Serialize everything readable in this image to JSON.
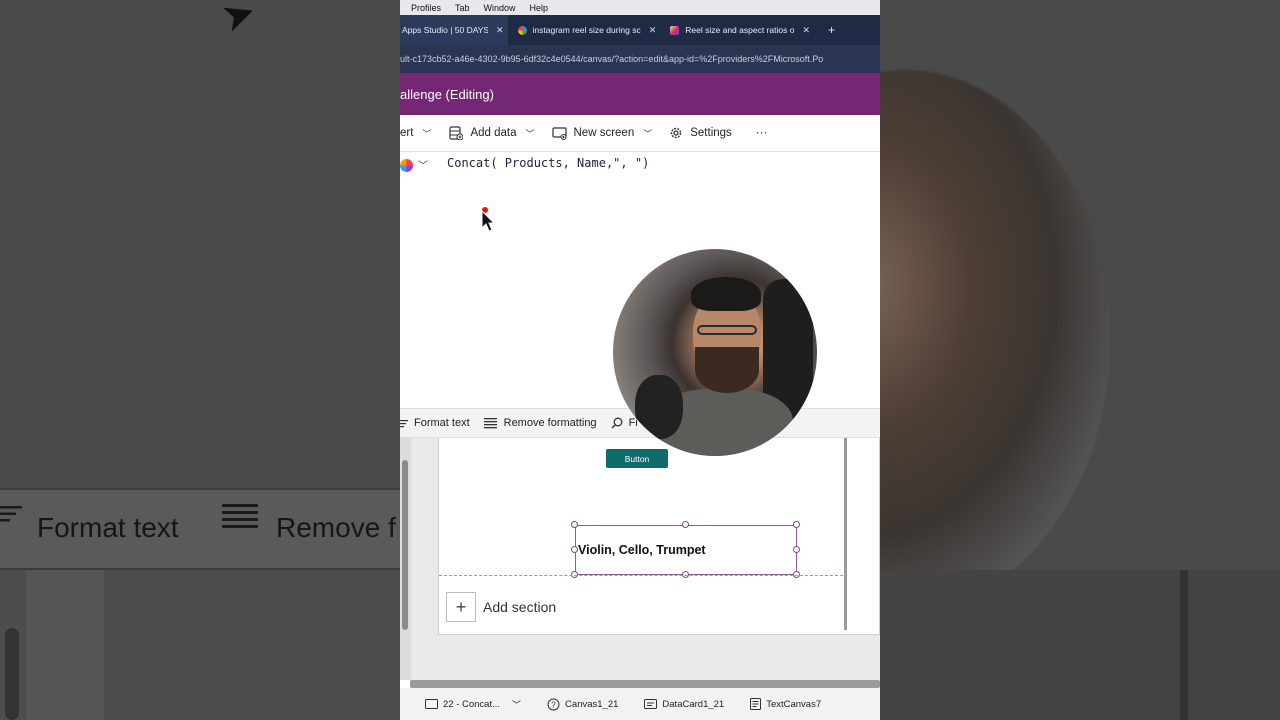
{
  "mac_menu": {
    "items": [
      "Profiles",
      "Tab",
      "Window",
      "Help"
    ]
  },
  "browser": {
    "tabs": [
      {
        "label": "Apps Studio  |  50 DAYS",
        "icon": "power-apps-icon",
        "active": true
      },
      {
        "label": "instagram reel size during sc",
        "icon": "google-icon",
        "active": false
      },
      {
        "label": "Reel size and aspect ratios o",
        "icon": "instagram-icon",
        "active": false
      }
    ],
    "close_glyph": "✕",
    "new_tab_glyph": "+",
    "url": "ult-c173cb52-a46e-4302-9b95-6df32c4e0544/canvas/?action=edit&app-id=%2Fproviders%2FMicrosoft.Po"
  },
  "app": {
    "title": "allenge (Editing)"
  },
  "command_bar": {
    "insert_label": "ert",
    "add_data_label": "Add data",
    "new_screen_label": "New screen",
    "settings_label": "Settings",
    "more_label": "···"
  },
  "formula_bar": {
    "formula": "Concat( Products, Name,\", \")"
  },
  "format_toolbar": {
    "format_text_label": "Format text",
    "remove_formatting_label": "Remove formatting",
    "find_label": "Fi"
  },
  "canvas": {
    "button_label": "Button",
    "text_value": "Violin, Cello, Trumpet",
    "add_section_label": "Add section"
  },
  "breadcrumbs": [
    {
      "label": "22 - Concat...",
      "icon": "screen-icon"
    },
    {
      "label": "Canvas1_21",
      "icon": "canvas-icon"
    },
    {
      "label": "DataCard1_21",
      "icon": "datacard-icon"
    },
    {
      "label": "TextCanvas7",
      "icon": "text-icon"
    }
  ],
  "background": {
    "format_text_label": "Format text",
    "remove_label": "Remove f"
  },
  "colors": {
    "title_bar": "#742774",
    "tab_bar": "#1f2a44",
    "button": "#0f6a6a",
    "selection": "#8e5aa0"
  }
}
